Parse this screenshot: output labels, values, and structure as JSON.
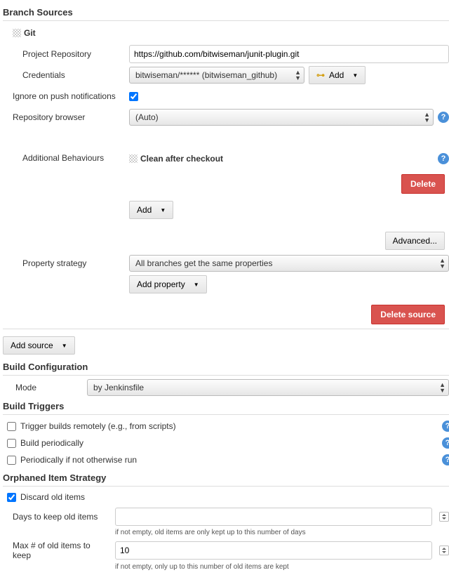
{
  "branch_sources": {
    "header": "Branch Sources",
    "git": {
      "title": "Git",
      "repo_label": "Project Repository",
      "repo_value": "https://github.com/bitwiseman/junit-plugin.git",
      "credentials_label": "Credentials",
      "credentials_value": "bitwiseman/****** (bitwiseman_github)",
      "add_label": "Add",
      "ignore_push_label": "Ignore on push notifications",
      "repo_browser_label": "Repository browser",
      "repo_browser_value": "(Auto)",
      "additional_behaviours_label": "Additional Behaviours",
      "behaviour_title": "Clean after checkout",
      "behaviour_delete": "Delete",
      "behaviour_add": "Add",
      "advanced_label": "Advanced...",
      "property_strategy_label": "Property strategy",
      "property_strategy_value": "All branches get the same properties",
      "add_property_label": "Add property",
      "delete_source_label": "Delete source"
    },
    "add_source_label": "Add source"
  },
  "build_config": {
    "header": "Build Configuration",
    "mode_label": "Mode",
    "mode_value": "by Jenkinsfile"
  },
  "build_triggers": {
    "header": "Build Triggers",
    "remote": "Trigger builds remotely (e.g., from scripts)",
    "periodic": "Build periodically",
    "otherwise": "Periodically if not otherwise run"
  },
  "orphaned": {
    "header": "Orphaned Item Strategy",
    "discard": "Discard old items",
    "days_label": "Days to keep old items",
    "days_value": "",
    "days_hint": "if not empty, old items are only kept up to this number of days",
    "max_label": "Max # of old items to keep",
    "max_value": "10",
    "max_hint": "if not empty, only up to this number of old items are kept"
  }
}
